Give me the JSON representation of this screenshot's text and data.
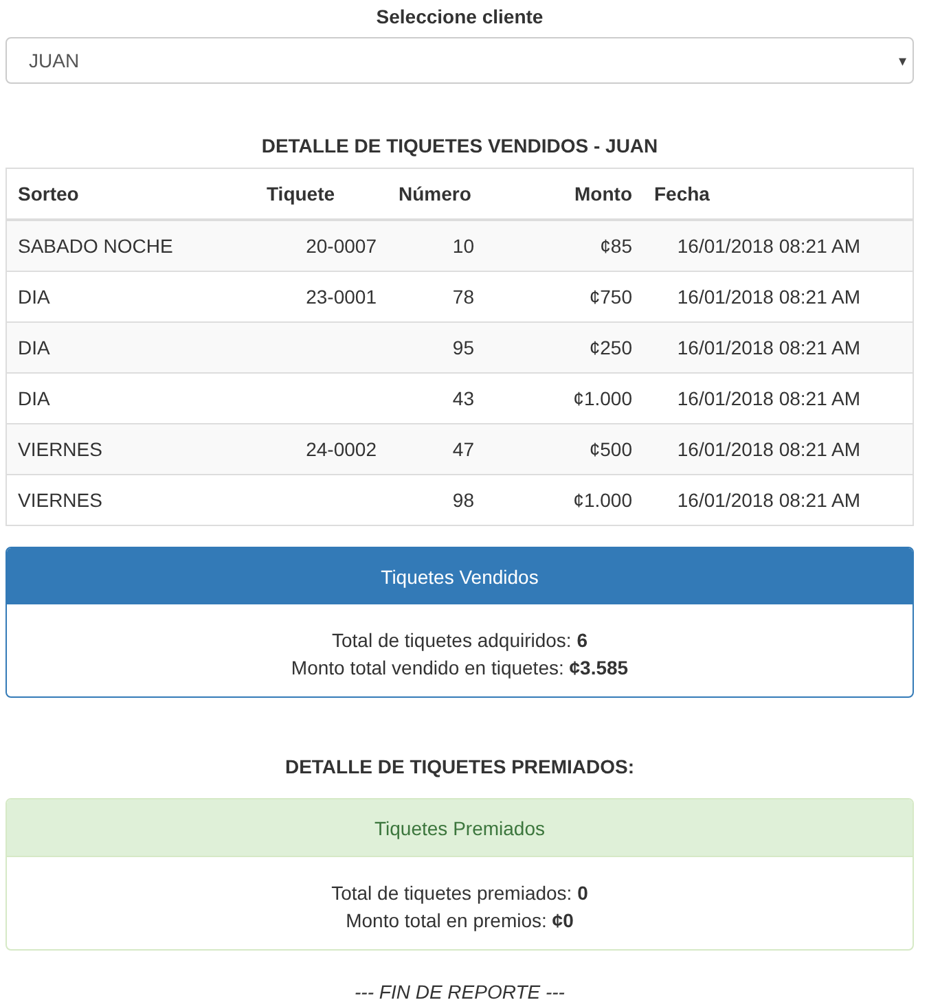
{
  "client_select": {
    "label": "Seleccione cliente",
    "value": "JUAN",
    "caret": "▾"
  },
  "sold_section": {
    "title": "DETALLE DE TIQUETES VENDIDOS - JUAN",
    "table": {
      "columns": [
        "Sorteo",
        "Tiquete",
        "Número",
        "Monto",
        "Fecha"
      ],
      "rows": [
        {
          "sorteo": "SABADO NOCHE",
          "tiquete": "20-0007",
          "numero": "10",
          "monto": "¢85",
          "fecha": "16/01/2018 08:21 AM"
        },
        {
          "sorteo": "DIA",
          "tiquete": "23-0001",
          "numero": "78",
          "monto": "¢750",
          "fecha": "16/01/2018 08:21 AM"
        },
        {
          "sorteo": "DIA",
          "numero": "95",
          "monto": "¢250",
          "fecha": "16/01/2018 08:21 AM"
        },
        {
          "sorteo": "DIA",
          "numero": "43",
          "monto": "¢1.000",
          "fecha": "16/01/2018 08:21 AM"
        },
        {
          "sorteo": "VIERNES",
          "tiquete": "24-0002",
          "numero": "47",
          "monto": "¢500",
          "fecha": "16/01/2018 08:21 AM"
        },
        {
          "sorteo": "VIERNES",
          "numero": "98",
          "monto": "¢1.000",
          "fecha": "16/01/2018 08:21 AM"
        }
      ]
    },
    "panel": {
      "kind": "primary",
      "heading": "Tiquetes Vendidos",
      "lines": [
        "Total de tiquetes adquiridos: **6**",
        "Monto total vendido en tiquetes: **¢3.585**"
      ]
    }
  },
  "prize_section": {
    "title": "DETALLE DE TIQUETES PREMIADOS:",
    "panel": {
      "kind": "success",
      "heading": "Tiquetes Premiados",
      "lines": [
        "Total de tiquetes premiados: **0**",
        "Monto total en premios: **¢0**"
      ]
    }
  },
  "footer": "--- FIN DE REPORTE ---"
}
